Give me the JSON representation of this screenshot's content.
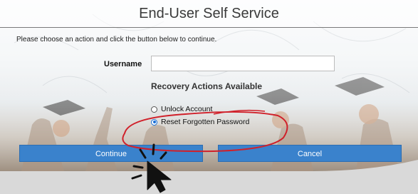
{
  "header": {
    "title": "End-User Self Service"
  },
  "form": {
    "instruction": "Please choose an action and click the button below to continue.",
    "username_label": "Username",
    "username_value": "",
    "username_placeholder": "",
    "recovery_title": "Recovery Actions Available",
    "options": [
      {
        "label": "Unlock Account",
        "selected": false
      },
      {
        "label": "Reset Forgotten Password",
        "selected": true
      }
    ]
  },
  "buttons": {
    "continue_label": "Continue",
    "cancel_label": "Cancel"
  },
  "annotations": {
    "highlight_color": "#d0202a",
    "cursor_icon": "mouse-pointer-icon"
  },
  "colors": {
    "button_blue": "#3a82cc",
    "radio_selected": "#1a6fd6"
  }
}
